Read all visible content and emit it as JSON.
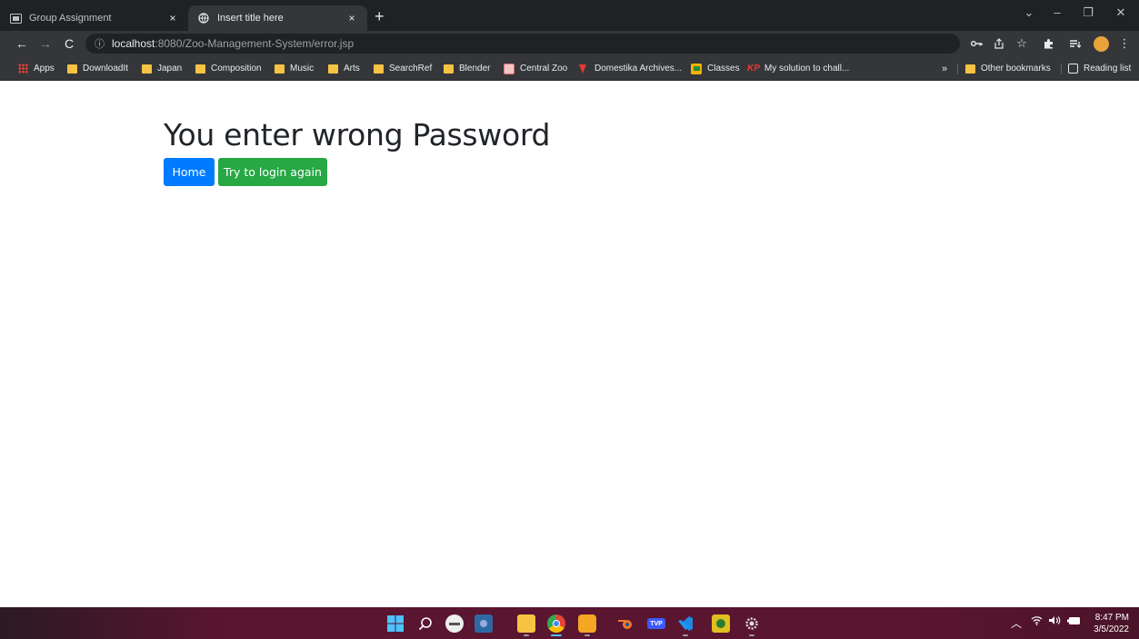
{
  "browser": {
    "tabs": [
      {
        "label": "Group Assignment",
        "icon": "slides-icon"
      },
      {
        "label": "Insert title here",
        "icon": "globe-icon"
      }
    ],
    "tab_close": "×",
    "new_tab": "+",
    "window_controls": {
      "chevron": "⌄",
      "minimize": "–",
      "restore": "❐",
      "close": "✕"
    },
    "address": {
      "host": "localhost",
      "path": ":8080/Zoo-Management-System/error.jsp"
    },
    "bookmarks": [
      {
        "label": "Apps",
        "icon": "apps-grid-icon"
      },
      {
        "label": "DownloadIt",
        "icon": "folder-icon"
      },
      {
        "label": "Japan",
        "icon": "folder-icon"
      },
      {
        "label": "Composition",
        "icon": "folder-icon"
      },
      {
        "label": "Music",
        "icon": "folder-icon"
      },
      {
        "label": "Arts",
        "icon": "folder-icon"
      },
      {
        "label": "SearchRef",
        "icon": "folder-icon"
      },
      {
        "label": "Blender",
        "icon": "folder-icon"
      },
      {
        "label": "Central Zoo",
        "icon": "zoo-favicon"
      },
      {
        "label": "Domestika Archives...",
        "icon": "domestika-favicon"
      },
      {
        "label": "Classes",
        "icon": "classroom-favicon"
      },
      {
        "label": "My solution to chall...",
        "icon": "kp-favicon"
      }
    ],
    "overflow": "»",
    "other_bookmarks": "Other bookmarks",
    "reading_list": "Reading list"
  },
  "page": {
    "heading": "You enter wrong Password",
    "home_button": "Home",
    "retry_button": "Try to login again"
  },
  "taskbar": {
    "time": "8:47 PM",
    "date": "3/5/2022"
  },
  "colors": {
    "primary": "#007bff",
    "success": "#28a745",
    "chrome_dark": "#202124",
    "chrome_toolbar": "#35363a"
  }
}
